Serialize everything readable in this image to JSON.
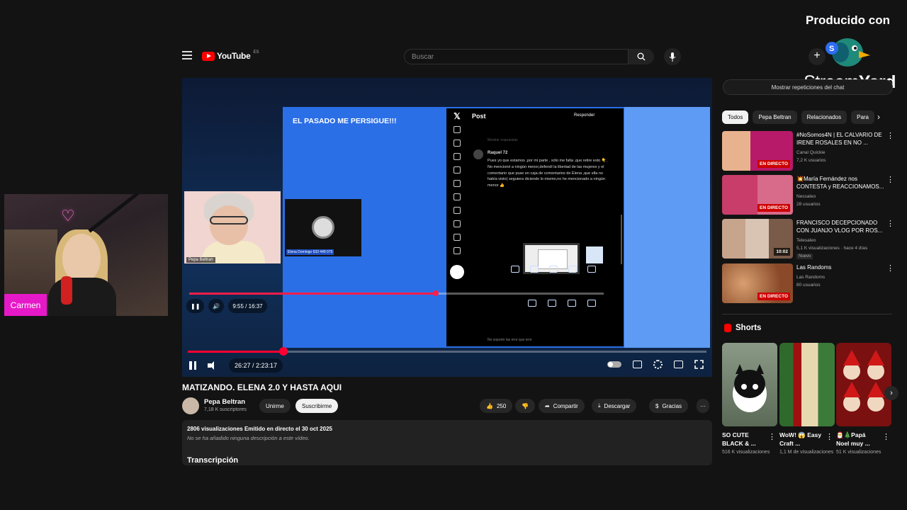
{
  "overlay": {
    "produced_by": "Producido con",
    "brand_stream": "Stream",
    "brand_yard": "Yard",
    "camera_label": "Carmen",
    "camera_neon": "♡"
  },
  "header": {
    "logo_text": "YouTube",
    "logo_region": "ES",
    "search_placeholder": "Buscar",
    "create_label": "+"
  },
  "player": {
    "shared_title": "EL PASADO ME PERSIGUE!!!",
    "participant_name": "Pepa Beltran",
    "guest_name": "Elena Domingo 633 449 075",
    "x_post": {
      "heading": "Post",
      "reply_button": "Responder",
      "show_replies": "Mostrar respuestas",
      "user": "Raquel 72",
      "text": "Pues yo que estamos ,por mi parte , sólo me falta ,que retire esto 👇. No mencioné a ningún menor,defendí la libertad de las mujeres y el comentario que puse en caja de comentarios de Elena ,que ella no había visto( seguiera diciendo lo mismo,no he mencionado a ningún menor 👍",
      "footer": "No soporto las erre que erre"
    },
    "inner_time": "9:55 / 16:37",
    "inner_progress": 0.595,
    "outer_time": "26:27 / 2:23:17",
    "outer_progress": 0.185
  },
  "video": {
    "title": "MATIZANDO. ELENA 2.0 Y HASTA AQUI",
    "channel": "Pepa Beltran",
    "subscribers": "7,18 K suscriptores",
    "join_label": "Unirme",
    "subscribe_label": "Suscribirme",
    "likes": "250",
    "share_label": "Compartir",
    "download_label": "Descargar",
    "thanks_label": "Gracias",
    "more_label": "···",
    "stats": "2806 visualizaciones  Emitido en directo el 30 oct 2025",
    "description_empty": "No se ha añadido ninguna descripción a este vídeo.",
    "transcript_label": "Transcripción"
  },
  "sidebar": {
    "replay_bar": "Mostrar repeticiones del chat",
    "chips": [
      "Todos",
      "Pepa Beltran",
      "Relacionados",
      "Para"
    ],
    "recommendations": [
      {
        "title": "#NoSomos4N | EL CALVARIO DE IRENE ROSALES EN NO ...",
        "channel": "Canal Quickie",
        "meta": "7,2 K usuarios",
        "live": "EN DIRECTO",
        "thumb_color": "#b81a6a"
      },
      {
        "title": "💥María Fernández nos CONTESTA y REACCIONAMOS...",
        "channel": "Nessaleo",
        "meta": "28 usuarios",
        "live": "EN DIRECTO",
        "thumb_color": "#c93d6b"
      },
      {
        "title": "FRANCISCO DECEPCIONADO CON JUANJO VLOG POR ROS...",
        "channel": "Telesaleo",
        "meta": "5,1 K visualizaciones · hace 4 días",
        "badge": "Nuevo",
        "duration": "10:02",
        "thumb_color": "#2a3b2f"
      },
      {
        "title": "Las Randoms",
        "channel": "Las Randoms",
        "meta": "80 usuarios",
        "live": "EN DIRECTO",
        "thumb_color": "#8a4a2a"
      }
    ],
    "shorts_label": "Shorts",
    "shorts": [
      {
        "title": "SO CUTE BLACK & ...",
        "views": "516 K visualizaciones",
        "thumb_color": "#6f7c6a"
      },
      {
        "title": "WoW! 😱 Easy Craft ...",
        "views": "1,1 M de visualizaciones",
        "thumb_color": "#3c7a3a"
      },
      {
        "title": "🎅🎄Papá Noel muy ...",
        "views": "51 K visualizaciones",
        "thumb_color": "#b01a1a"
      }
    ]
  },
  "colors": {
    "accent_red": "#ff0033",
    "shared_bg": "#2b6fe6",
    "camera_label_bg": "#e619c8"
  }
}
